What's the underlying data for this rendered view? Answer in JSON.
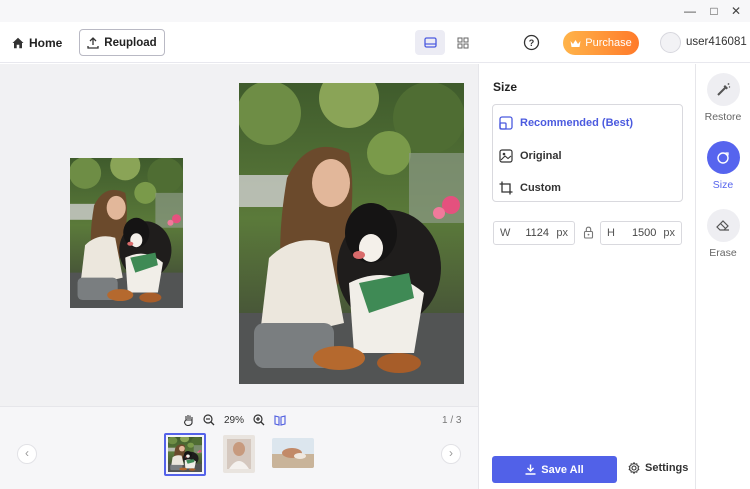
{
  "toolbar": {
    "home_label": "Home",
    "reupload_label": "Reupload",
    "purchase_label": "Purchase",
    "username": "user416081"
  },
  "bottom": {
    "zoom": "29%",
    "page_count": "1 / 3"
  },
  "panel": {
    "title": "Size",
    "options": [
      {
        "label": "Recommended (Best)",
        "icon": "recommended-size-icon",
        "selected": true
      },
      {
        "label": "Original",
        "icon": "image-icon",
        "selected": false
      },
      {
        "label": "Custom",
        "icon": "crop-icon",
        "selected": false
      }
    ],
    "width": {
      "label": "W",
      "value": "1124",
      "unit": "px"
    },
    "height": {
      "label": "H",
      "value": "1500",
      "unit": "px"
    },
    "save_all_label": "Save All",
    "settings_label": "Settings"
  },
  "tools": [
    {
      "label": "Restore",
      "icon": "magic-wand-icon",
      "active": false
    },
    {
      "label": "Size",
      "icon": "size-icon",
      "active": true
    },
    {
      "label": "Erase",
      "icon": "eraser-icon",
      "active": false
    }
  ],
  "colors": {
    "accent": "#5664ee",
    "purchase_start": "#ffb44a",
    "purchase_end": "#ff7a2a"
  }
}
